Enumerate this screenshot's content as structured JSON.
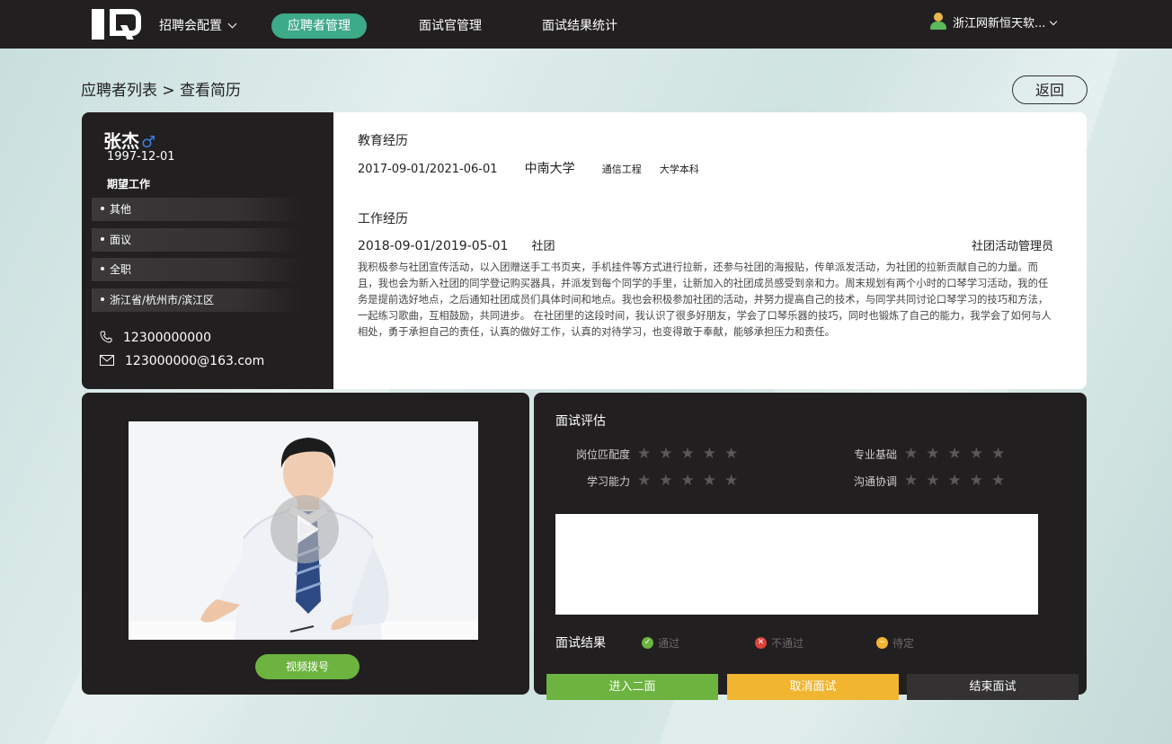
{
  "colors": {
    "nav_bg": "#221f20",
    "accent_green": "#3daa88",
    "pass_green": "#6cb33f",
    "cancel_yellow": "#f1b530",
    "end_dark": "#333132"
  },
  "nav": {
    "items": [
      {
        "label": "招聘会配置"
      },
      {
        "label": "应聘者管理",
        "active": true
      },
      {
        "label": "面试官管理"
      },
      {
        "label": "面试结果统计"
      }
    ],
    "user": "浙江网新恒天软..."
  },
  "breadcrumb": "应聘者列表 > 查看简历",
  "back_label": "返回",
  "profile": {
    "name": "张杰",
    "gender_symbol": "♂",
    "birth": "1997-12-01",
    "expect_label": "期望工作",
    "tags": [
      "其他",
      "面议",
      "全职",
      "浙江省/杭州市/滨江区"
    ],
    "phone": "12300000000",
    "email": "123000000@163.com"
  },
  "education": {
    "title": "教育经历",
    "period": "2017-09-01/2021-06-01",
    "school": "中南大学",
    "major": "通信工程",
    "degree": "大学本科"
  },
  "work": {
    "title": "工作经历",
    "period": "2018-09-01/2019-05-01",
    "org": "社团",
    "role": "社团活动管理员",
    "description": "我积极参与社团宣传活动，以入团赠送手工书页夹，手机挂件等方式进行拉新，还参与社团的海报贴，传单派发活动，为社团的拉新贡献自己的力量。而且，我也会为新入社团的同学登记购买器具，并派发到每个同学的手里，让新加入的社团成员感受到亲和力。周末规划有两个小时的口琴学习活动，我的任务是提前选好地点，之后通知社团成员们具体时间和地点。我也会积极参加社团的活动，并努力提高自己的技术，与同学共同讨论口琴学习的技巧和方法，一起练习歌曲，互相鼓励，共同进步。 在社团里的这段时间，我认识了很多好朋友，学会了口琴乐器的技巧，同时也锻炼了自己的能力，我学会了如何与人相处，勇于承担自己的责任，认真的做好工作，认真的对待学习，也变得敢于奉献，能够承担压力和责任。"
  },
  "video": {
    "dial_label": "视频拨号"
  },
  "evaluation": {
    "title": "面试评估",
    "ratings": [
      {
        "label": "岗位匹配度",
        "stars": 0,
        "max": 5
      },
      {
        "label": "专业基础",
        "stars": 0,
        "max": 5
      },
      {
        "label": "学习能力",
        "stars": 0,
        "max": 5
      },
      {
        "label": "沟通协调",
        "stars": 0,
        "max": 5
      }
    ],
    "notes_value": "",
    "result_label": "面试结果",
    "options": [
      {
        "label": "通过",
        "icon": "check-circle-icon"
      },
      {
        "label": "不通过",
        "icon": "x-circle-icon"
      },
      {
        "label": "待定",
        "icon": "minus-circle-icon"
      }
    ],
    "buttons": {
      "second": "进入二面",
      "cancel": "取消面试",
      "end": "结束面试"
    }
  }
}
